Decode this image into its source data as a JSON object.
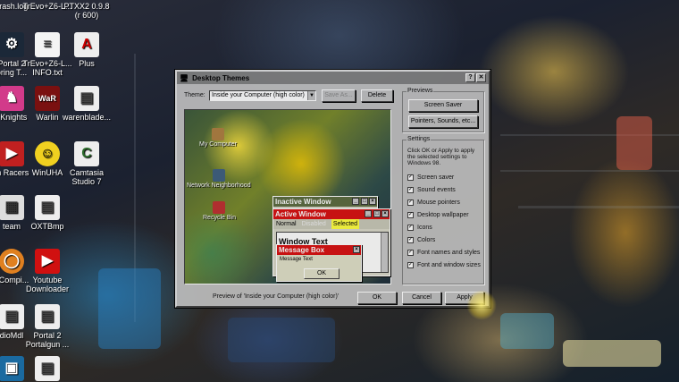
{
  "desktop_icons": [
    {
      "label1": "crash.log",
      "label2": "",
      "icon": "text-file-icon"
    },
    {
      "label1": "TrEvo+Z6-L...",
      "label2": "",
      "icon": "text-file-icon"
    },
    {
      "label1": "PTXX2 0.9.8",
      "label2": "(r 600)",
      "icon": "app-icon"
    },
    {
      "label1": "Portal 2",
      "label2": "oring T...",
      "icon": "steam-icon"
    },
    {
      "label1": "TrEvo+Z6-L...",
      "label2": "INFO.txt",
      "icon": "text-file-icon"
    },
    {
      "label1": "Plus",
      "label2": "",
      "icon": "app-icon"
    },
    {
      "label1": "l Knights",
      "label2": "",
      "icon": "game-icon"
    },
    {
      "label1": "Warlin",
      "label2": "",
      "icon": "game-icon"
    },
    {
      "label1": "warenblade...",
      "label2": "",
      "icon": "game-icon"
    },
    {
      "label1": "m Racers",
      "label2": "",
      "icon": "game-icon"
    },
    {
      "label1": "WinUHA",
      "label2": "",
      "icon": "smiley-icon"
    },
    {
      "label1": "Camtasia",
      "label2": "Studio 7",
      "icon": "camtasia-icon"
    },
    {
      "label1": "team",
      "label2": "",
      "icon": "steam-icon"
    },
    {
      "label1": "OXTBmp",
      "label2": "",
      "icon": "document-icon"
    },
    {
      "label1": "oCompi...",
      "label2": "",
      "icon": "portal-icon"
    },
    {
      "label1": "Youtube",
      "label2": "Downloader",
      "icon": "youtube-icon"
    },
    {
      "label1": "dioMdl",
      "label2": "",
      "icon": "document-icon"
    },
    {
      "label1": "Portal 2",
      "label2": "Portalgun ...",
      "icon": "document-icon"
    }
  ],
  "dialog": {
    "title": "Desktop Themes",
    "theme_label": "Theme:",
    "theme_value": "Inside your Computer (high color)",
    "save_as": "Save As...",
    "delete": "Delete",
    "previews_label": "Previews",
    "screen_saver": "Screen Saver",
    "pointers_sounds": "Pointers, Sounds, etc...",
    "settings_label": "Settings",
    "settings_hint": "Click OK or Apply to apply the selected settings to Windows 98.",
    "settings": [
      {
        "label": "Screen saver",
        "checked": true
      },
      {
        "label": "Sound events",
        "checked": true
      },
      {
        "label": "Mouse pointers",
        "checked": true
      },
      {
        "label": "Desktop wallpaper",
        "checked": true
      },
      {
        "label": "Icons",
        "checked": true
      },
      {
        "label": "Colors",
        "checked": true
      },
      {
        "label": "Font names and styles",
        "checked": true
      },
      {
        "label": "Font and window sizes",
        "checked": true
      }
    ],
    "preview_caption": "Preview of 'Inside your Computer (high color)'",
    "ok": "OK",
    "cancel": "Cancel",
    "apply": "Apply",
    "preview": {
      "icons": [
        "My Computer",
        "Network Neighborhood",
        "Recycle Bin"
      ],
      "inactive_window": "Inactive Window",
      "active_window": "Active Window",
      "menu_normal": "Normal",
      "menu_disabled": "Disabled",
      "menu_selected": "Selected",
      "window_text": "Window Text",
      "message_box": "Message Box",
      "message_text": "Message Text",
      "message_ok": "OK"
    }
  },
  "colors": {
    "active_title": "#d81010",
    "inactive_title": "#5c6b40",
    "highlight": "#ffff40"
  }
}
